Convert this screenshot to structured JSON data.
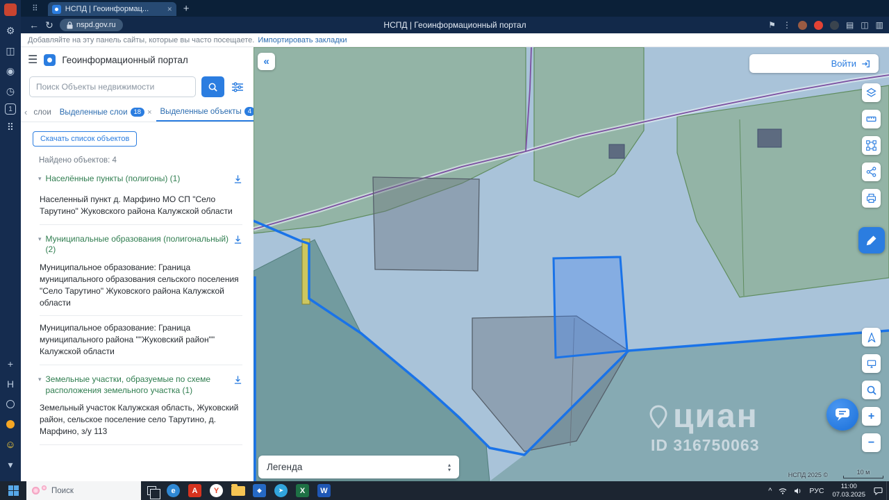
{
  "browser": {
    "tab_title": "НСПД | Геоинформац...",
    "url": "nspd.gov.ru",
    "page_title": "НСПД | Геоинформационный портал",
    "bookmarks_hint": "Добавляйте на эту панель сайты, которые вы часто посещаете.",
    "bookmarks_link": "Импортировать закладки"
  },
  "icons": {
    "hamburger": "☰",
    "back": "←",
    "refresh": "↻",
    "kebab": "⋮",
    "flag": "⚑",
    "collections": "▤",
    "tabs_glyph": "◫",
    "sidebar_glyph": "▥",
    "chevron_left": "‹",
    "close": "×",
    "new_tab": "+",
    "caret_down": "▾",
    "caret_up": "▴",
    "plus": "+",
    "minus": "−",
    "collapse": "«",
    "chevron_up": "^",
    "gear": "⚙",
    "camera": "◉",
    "clock": "◷",
    "grid": "⠿",
    "smiley": "☺",
    "letter_h": "H",
    "rail_tab_count": "1"
  },
  "panel": {
    "title": "Геоинформационный портал",
    "search_placeholder": "Поиск Объекты недвижимости",
    "tabs": [
      {
        "label": "слои"
      },
      {
        "label": "Выделенные слои",
        "badge": "18"
      },
      {
        "label": "Выделенные объекты",
        "badge": "4"
      }
    ],
    "download_button": "Скачать список объектов",
    "found": "Найдено объектов: 4",
    "groups": [
      {
        "title": "Населённые пункты (полигоны) (1)",
        "items": [
          "Населенный пункт д. Марфино МО СП \"Село Тарутино\" Жуковского района Калужской области"
        ]
      },
      {
        "title": "Муниципальные образования (полигональный) (2)",
        "items": [
          "Муниципальное образование: Граница муниципального образования сельского поселения \"Село Тарутино\" Жуковского района Калужской области",
          "Муниципальное образование: Граница муниципального района \"\"Жуковский район\"\" Калужской области"
        ]
      },
      {
        "title": "Земельные участки, образуемые по схеме расположения земельного участка (1)",
        "items": [
          "Земельный участок Калужская область, Жуковский район, сельское поселение село Тарутино, д. Марфино, з/у 113"
        ]
      }
    ]
  },
  "map": {
    "login": "Войти",
    "legend": "Легенда",
    "watermark_brand": "циан",
    "watermark_id": "ID 316750063",
    "attribution": "НСПД 2025 ©",
    "scale": "10 м"
  },
  "taskbar": {
    "search_placeholder": "Поиск",
    "lang": "РУС",
    "time": "11:00",
    "date": "07.03.2025",
    "apps": {
      "edge": "e",
      "acrobat": "A",
      "yandex": "Y",
      "photos": "◆",
      "telegram": "➤",
      "excel": "X",
      "word": "W"
    }
  },
  "colors": {
    "accent_blue": "#2b7de0",
    "selected_parcel_blue": "#1a73e8",
    "municipal_purple": "#7b4fa0",
    "landuse_green": "#7da573",
    "region_teal": "#467a70",
    "group_title_green": "#2f7d4f"
  }
}
